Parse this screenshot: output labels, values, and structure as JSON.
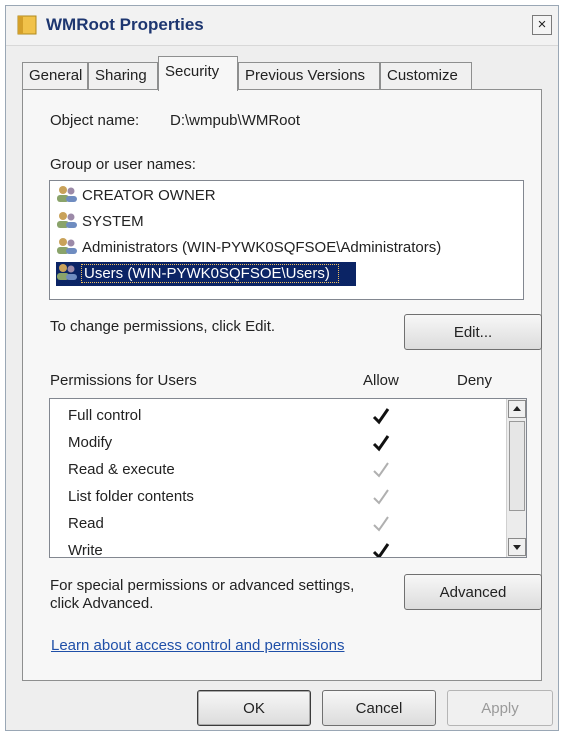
{
  "window": {
    "title": "WMRoot Properties",
    "close_label": "×"
  },
  "tabs": [
    {
      "label": "General"
    },
    {
      "label": "Sharing"
    },
    {
      "label": "Security"
    },
    {
      "label": "Previous Versions"
    },
    {
      "label": "Customize"
    }
  ],
  "security": {
    "object_name_label": "Object name:",
    "object_name_value": "D:\\wmpub\\WMRoot",
    "group_label": "Group or user names:",
    "users": [
      {
        "label": "CREATOR OWNER",
        "selected": false
      },
      {
        "label": "SYSTEM",
        "selected": false
      },
      {
        "label": "Administrators (WIN-PYWK0SQFSOE\\Administrators)",
        "selected": false
      },
      {
        "label": "Users (WIN-PYWK0SQFSOE\\Users)",
        "selected": true
      }
    ],
    "change_text": "To change permissions, click Edit.",
    "edit_button": "Edit...",
    "permissions_header": "Permissions for Users",
    "allow_header": "Allow",
    "deny_header": "Deny",
    "permissions": [
      {
        "name": "Full control",
        "allow": "explicit"
      },
      {
        "name": "Modify",
        "allow": "explicit"
      },
      {
        "name": "Read & execute",
        "allow": "inherited"
      },
      {
        "name": "List folder contents",
        "allow": "inherited"
      },
      {
        "name": "Read",
        "allow": "inherited"
      },
      {
        "name": "Write",
        "allow": "explicit"
      }
    ],
    "special_text_line1": "For special permissions or advanced settings,",
    "special_text_line2": "click Advanced.",
    "advanced_button": "Advanced",
    "learn_link": "Learn about access control and permissions"
  },
  "footer": {
    "ok": "OK",
    "cancel": "Cancel",
    "apply": "Apply"
  },
  "colors": {
    "selection": "#0b2465",
    "title_text": "#1d3670",
    "link": "#1f4fa8",
    "check_explicit": "#111111",
    "check_inherited": "#b0b0b0"
  }
}
